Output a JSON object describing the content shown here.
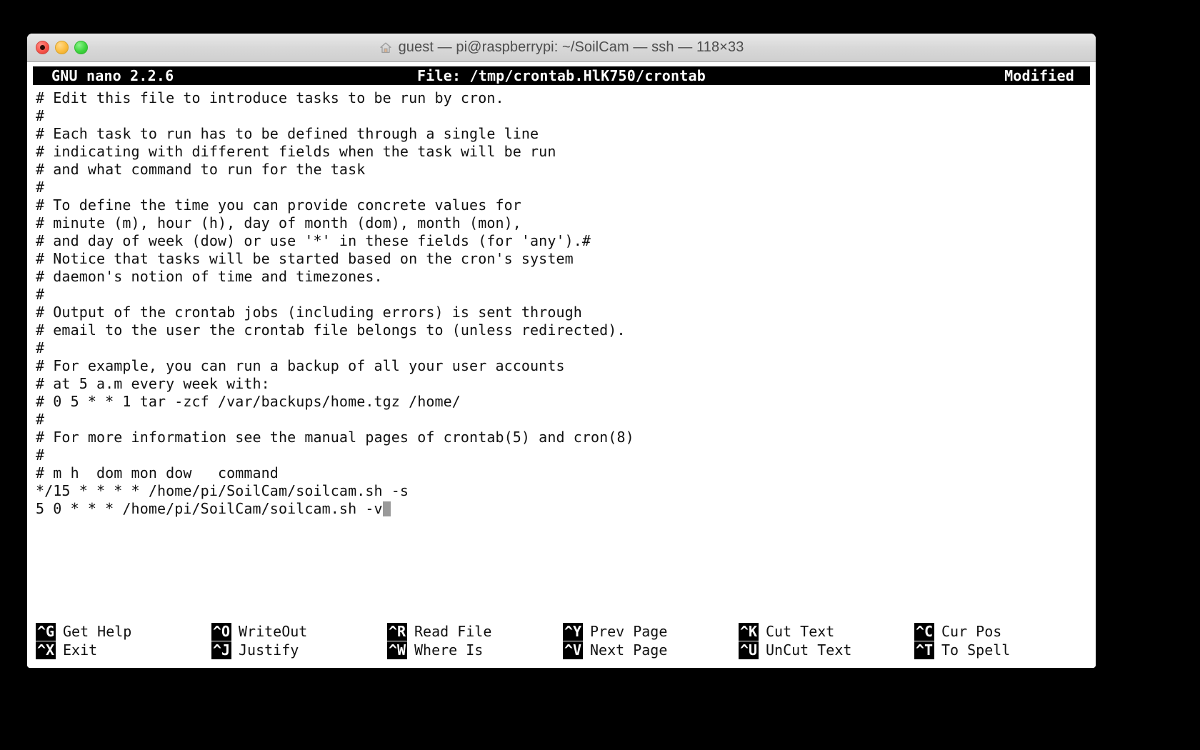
{
  "window": {
    "title": "guest — pi@raspberrypi: ~/SoilCam — ssh — 118×33",
    "proxy_icon": "home-icon",
    "controls": {
      "close": "close-button",
      "minimize": "minimize-button",
      "maximize": "maximize-button"
    }
  },
  "nano": {
    "version_label": "GNU nano 2.2.6",
    "file_label": "File: /tmp/crontab.HlK750/crontab",
    "modified_label": "Modified",
    "editor_lines": [
      "# Edit this file to introduce tasks to be run by cron.",
      "#",
      "# Each task to run has to be defined through a single line",
      "# indicating with different fields when the task will be run",
      "# and what command to run for the task",
      "#",
      "# To define the time you can provide concrete values for",
      "# minute (m), hour (h), day of month (dom), month (mon),",
      "# and day of week (dow) or use '*' in these fields (for 'any').#",
      "# Notice that tasks will be started based on the cron's system",
      "# daemon's notion of time and timezones.",
      "#",
      "# Output of the crontab jobs (including errors) is sent through",
      "# email to the user the crontab file belongs to (unless redirected).",
      "#",
      "# For example, you can run a backup of all your user accounts",
      "# at 5 a.m every week with:",
      "# 0 5 * * 1 tar -zcf /var/backups/home.tgz /home/",
      "#",
      "# For more information see the manual pages of crontab(5) and cron(8)",
      "#",
      "# m h  dom mon dow   command",
      "*/15 * * * * /home/pi/SoilCam/soilcam.sh -s",
      "5 0 * * * /home/pi/SoilCam/soilcam.sh -v"
    ],
    "cursor_line_index": 23,
    "shortcuts": [
      {
        "key": "^G",
        "label": "Get Help"
      },
      {
        "key": "^X",
        "label": "Exit"
      },
      {
        "key": "^O",
        "label": "WriteOut"
      },
      {
        "key": "^J",
        "label": "Justify"
      },
      {
        "key": "^R",
        "label": "Read File"
      },
      {
        "key": "^W",
        "label": "Where Is"
      },
      {
        "key": "^Y",
        "label": "Prev Page"
      },
      {
        "key": "^V",
        "label": "Next Page"
      },
      {
        "key": "^K",
        "label": "Cut Text"
      },
      {
        "key": "^U",
        "label": "UnCut Text"
      },
      {
        "key": "^C",
        "label": "Cur Pos"
      },
      {
        "key": "^T",
        "label": "To Spell"
      }
    ]
  },
  "colors": {
    "desktop": "#000000",
    "terminal_bg": "#000000",
    "editor_bg": "#ffffff",
    "editor_fg": "#111111",
    "close": "#f9564c",
    "minimize": "#fcbd3f",
    "maximize": "#3fd63f",
    "cursor": "#9a9a9a"
  }
}
